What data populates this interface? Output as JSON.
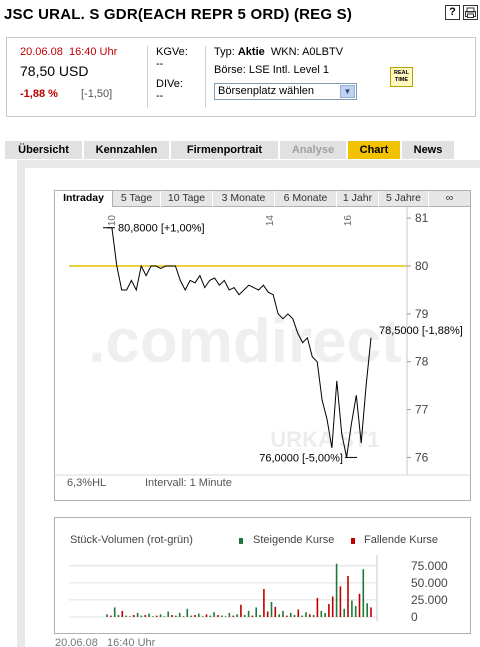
{
  "header": {
    "title": "JSC URAL. S GDR(EACH REPR 5 ORD) (REG S)",
    "icons": [
      "help-icon",
      "print-icon"
    ]
  },
  "quote": {
    "date": "20.06.08",
    "time": "16:40 Uhr",
    "price": "78,50 USD",
    "change_pct": "-1,88 %",
    "change_abs": "[-1,50]",
    "kgv_label": "KGVe:",
    "kgv_value": "--",
    "div_label": "DIVe:",
    "div_value": "--",
    "typ_label": "Typ:",
    "typ_value": "Aktie",
    "wkn_label": "WKN:",
    "wkn_value": "A0LBTV",
    "boerse_label": "Börse:",
    "boerse_value": "LSE Intl. Level 1",
    "select_value": "Börsenplatz wählen",
    "realtime_line1": "REAL",
    "realtime_line2": "TIME"
  },
  "tabs": [
    {
      "label": "Übersicht"
    },
    {
      "label": "Kennzahlen"
    },
    {
      "label": "Firmenportrait"
    },
    {
      "label": "Analyse"
    },
    {
      "label": "Chart"
    },
    {
      "label": "News"
    }
  ],
  "chart_tabs": [
    "Intraday",
    "5 Tage",
    "10 Tage",
    "3 Monate",
    "6 Monate",
    "1 Jahr",
    "5 Jahre",
    "∞"
  ],
  "chart_data": [
    {
      "type": "line",
      "y_ticks": [
        "81",
        "80",
        "79",
        "78",
        "77",
        "76"
      ],
      "x_ticks": [
        "10",
        "14",
        "16"
      ],
      "ylim": [
        75.8,
        81.15
      ],
      "reference_line": 80.0,
      "reference_color": "#e8c000",
      "series": [
        {
          "values": [
            80.8,
            80.8,
            80.0,
            79.5,
            79.5,
            79.7,
            79.5,
            80.0,
            79.8,
            80.0,
            80.0,
            79.95,
            80.0,
            80.0,
            80.0,
            79.7,
            79.5,
            79.7,
            79.65,
            79.8,
            79.55,
            79.7,
            79.75,
            79.6,
            79.7,
            79.5,
            79.55,
            79.4,
            79.5,
            79.6,
            79.55,
            79.5,
            79.6,
            79.45,
            79.4,
            79.0,
            78.9,
            79.0,
            78.9,
            78.6,
            78.4,
            78.5,
            78.1,
            78.0,
            77.2,
            76.8,
            76.2,
            77.6,
            76.5,
            76.0,
            76.7,
            77.3,
            76.3,
            77.5,
            78.5
          ]
        }
      ],
      "annotations": [
        "80,8000 [+1,00%]",
        "78,5000 [-1,88%]",
        "76,0000 [-5,00%]"
      ],
      "watermark_main": ".comdirect",
      "watermark_sub": "URKA ST1",
      "footer_hl": "6,3%HL",
      "footer_interval": "Intervall: 1 Minute"
    },
    {
      "type": "bar",
      "title": "Stück-Volumen (rot-grün)",
      "legend_up": "Steigende Kurse",
      "legend_down": "Fallende Kurse",
      "color_up": "#1a7a3a",
      "color_down": "#c00000",
      "y_ticks": [
        "75.000",
        "50.000",
        "25.000",
        "0"
      ],
      "ylim": [
        0,
        82000
      ],
      "values": [
        4000,
        2000,
        14000,
        3000,
        9000,
        2000,
        1000,
        3000,
        6000,
        2000,
        3000,
        5000,
        1000,
        2000,
        4000,
        1000,
        8000,
        3000,
        2000,
        6000,
        1000,
        12000,
        2000,
        3000,
        5000,
        1000,
        4000,
        2000,
        7000,
        3000,
        2000,
        1000,
        6000,
        2000,
        4000,
        18000,
        3000,
        9000,
        2000,
        14000,
        3000,
        41000,
        8000,
        22000,
        15000,
        4000,
        9000,
        2000,
        6000,
        3000,
        11000,
        2000,
        7000,
        4000,
        3000,
        28000,
        9000,
        6000,
        19000,
        30000,
        78000,
        45000,
        12000,
        60000,
        24000,
        16000,
        34000,
        70000,
        20000,
        14000
      ],
      "colors": [
        "up",
        "down",
        "up",
        "up",
        "down",
        "up",
        "up",
        "down",
        "up",
        "up",
        "down",
        "up",
        "up",
        "down",
        "up",
        "up",
        "up",
        "down",
        "up",
        "up",
        "down",
        "up",
        "up",
        "down",
        "up",
        "up",
        "down",
        "up",
        "up",
        "down",
        "up",
        "up",
        "up",
        "down",
        "up",
        "down",
        "up",
        "up",
        "down",
        "up",
        "up",
        "down",
        "down",
        "up",
        "down",
        "up",
        "up",
        "down",
        "up",
        "up",
        "down",
        "up",
        "up",
        "down",
        "up",
        "down",
        "up",
        "up",
        "down",
        "down",
        "up",
        "down",
        "up",
        "down",
        "up",
        "up",
        "down",
        "up",
        "up",
        "down"
      ]
    }
  ],
  "footer": {
    "date": "20.06.08",
    "time": "16:40 Uhr"
  }
}
